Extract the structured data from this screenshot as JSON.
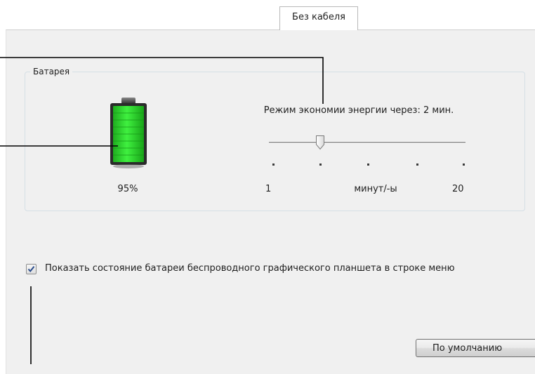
{
  "tabs": {
    "active_label": "Без кабеля"
  },
  "battery_group": {
    "title": "Батарея",
    "battery_percent_label": "95%",
    "battery_level": 0.95,
    "battery_color": "#2ed62e"
  },
  "power_saving": {
    "label": "Режим экономии энергии через: 2 мин.",
    "slider_value": 2,
    "slider_min_label": "1",
    "slider_max_label": "20",
    "unit_label": "минут/-ы"
  },
  "show_status": {
    "label": "Показать состояние батареи беспроводного графического планшета в строке меню",
    "checked": true
  },
  "footer": {
    "default_button_label": "По умолчанию"
  }
}
